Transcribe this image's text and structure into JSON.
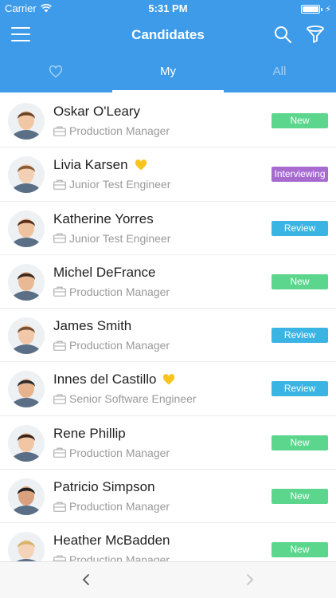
{
  "status_bar": {
    "carrier": "Carrier",
    "time": "5:31 PM"
  },
  "nav": {
    "title": "Candidates"
  },
  "tabs": [
    {
      "label": "",
      "icon": "heart-icon"
    },
    {
      "label": "My"
    },
    {
      "label": "All"
    }
  ],
  "candidates": [
    {
      "name": "Oskar O'Leary",
      "role": "Production Manager",
      "status": "New",
      "favorite": false
    },
    {
      "name": "Livia Karsen",
      "role": "Junior Test Engineer",
      "status": "Interviewing",
      "favorite": true
    },
    {
      "name": "Katherine Yorres",
      "role": "Junior Test Engineer",
      "status": "Review",
      "favorite": false
    },
    {
      "name": "Michel DeFrance",
      "role": "Production Manager",
      "status": "New",
      "favorite": false
    },
    {
      "name": "James Smith",
      "role": "Production Manager",
      "status": "Review",
      "favorite": false
    },
    {
      "name": "Innes del Castillo",
      "role": "Senior Software Engineer",
      "status": "Review",
      "favorite": true
    },
    {
      "name": "Rene Phillip",
      "role": "Production Manager",
      "status": "New",
      "favorite": false
    },
    {
      "name": "Patricio Simpson",
      "role": "Production Manager",
      "status": "New",
      "favorite": false
    },
    {
      "name": "Heather McBadden",
      "role": "Production Manager",
      "status": "New",
      "favorite": false
    }
  ],
  "status_colors": {
    "New": "#5cd68d",
    "Review": "#3ab4e3",
    "Interviewing": "#a76bd0"
  },
  "colors": {
    "header": "#3d9be9",
    "favorite": "#f7c51e"
  }
}
